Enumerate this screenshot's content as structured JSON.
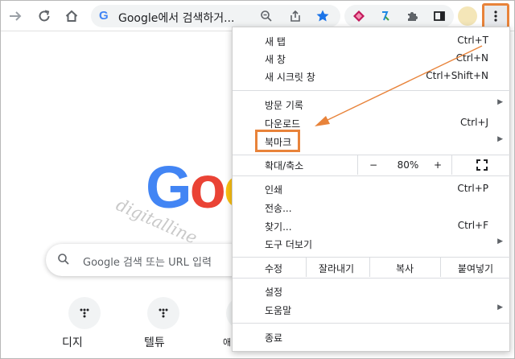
{
  "toolbar": {
    "omnibox_text": "Google에서 검색하거...",
    "omnibox_g": "G"
  },
  "page": {
    "logo": "Goo",
    "watermark": "digitalline",
    "search_placeholder": "Google 검색 또는 URL 입력",
    "shortcuts": [
      "디지",
      "텔튜",
      "애"
    ]
  },
  "menu": {
    "items": [
      {
        "label": "새 탭",
        "shortcut": "Ctrl+T"
      },
      {
        "label": "새 창",
        "shortcut": "Ctrl+N"
      },
      {
        "label": "새 시크릿 창",
        "shortcut": "Ctrl+Shift+N"
      },
      {
        "label": "방문 기록",
        "shortcut": ""
      },
      {
        "label": "다운로드",
        "shortcut": "Ctrl+J"
      },
      {
        "label": "북마크",
        "shortcut": ""
      },
      {
        "label": "인쇄",
        "shortcut": "Ctrl+P"
      },
      {
        "label": "전송...",
        "shortcut": ""
      },
      {
        "label": "찾기...",
        "shortcut": "Ctrl+F"
      },
      {
        "label": "도구 더보기",
        "shortcut": ""
      },
      {
        "label": "설정",
        "shortcut": ""
      },
      {
        "label": "도움말",
        "shortcut": ""
      },
      {
        "label": "종료",
        "shortcut": ""
      }
    ],
    "zoom": {
      "label": "확대/축소",
      "minus": "−",
      "value": "80%",
      "plus": "+"
    },
    "edit": {
      "label": "수정",
      "cut": "잘라내기",
      "copy": "복사",
      "paste": "붙여넣기"
    }
  },
  "colors": {
    "accent_highlight": "#e8833a"
  }
}
